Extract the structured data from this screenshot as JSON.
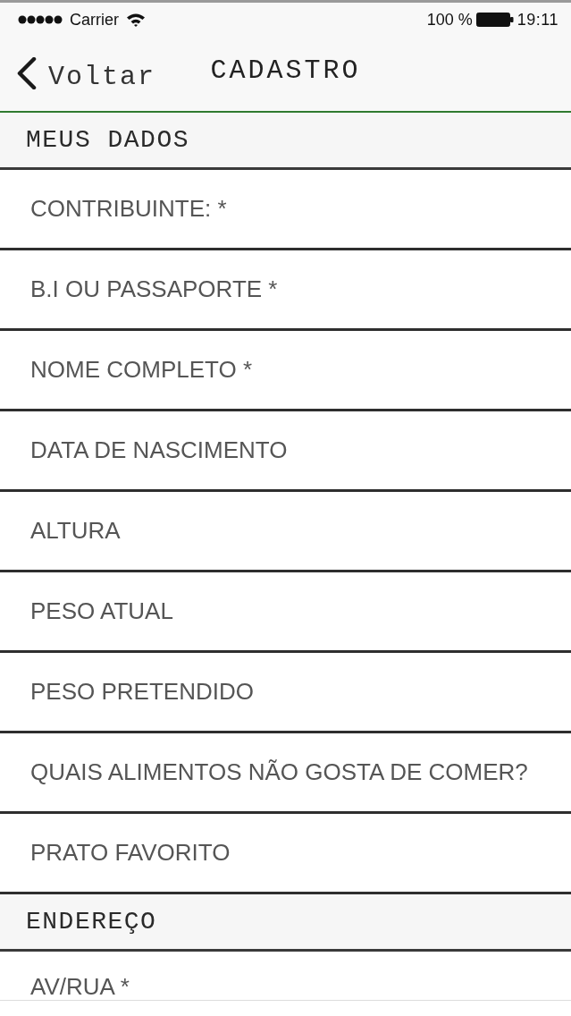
{
  "status_bar": {
    "carrier": "Carrier",
    "battery": "100 %",
    "time": "19:11"
  },
  "nav_bar": {
    "back_label": "Voltar",
    "title": "CADASTRO"
  },
  "sections": [
    {
      "title": "MEUS DADOS",
      "fields": [
        {
          "placeholder": "CONTRIBUINTE: *"
        },
        {
          "placeholder": "B.I OU PASSAPORTE *"
        },
        {
          "placeholder": "NOME COMPLETO *"
        },
        {
          "placeholder": "DATA DE NASCIMENTO"
        },
        {
          "placeholder": "ALTURA"
        },
        {
          "placeholder": "PESO ATUAL"
        },
        {
          "placeholder": "PESO PRETENDIDO"
        },
        {
          "placeholder": "QUAIS ALIMENTOS NÃO GOSTA DE COMER?"
        },
        {
          "placeholder": "PRATO FAVORITO"
        }
      ]
    },
    {
      "title": "ENDEREÇO",
      "fields": [
        {
          "placeholder": "AV/RUA *"
        }
      ]
    }
  ]
}
